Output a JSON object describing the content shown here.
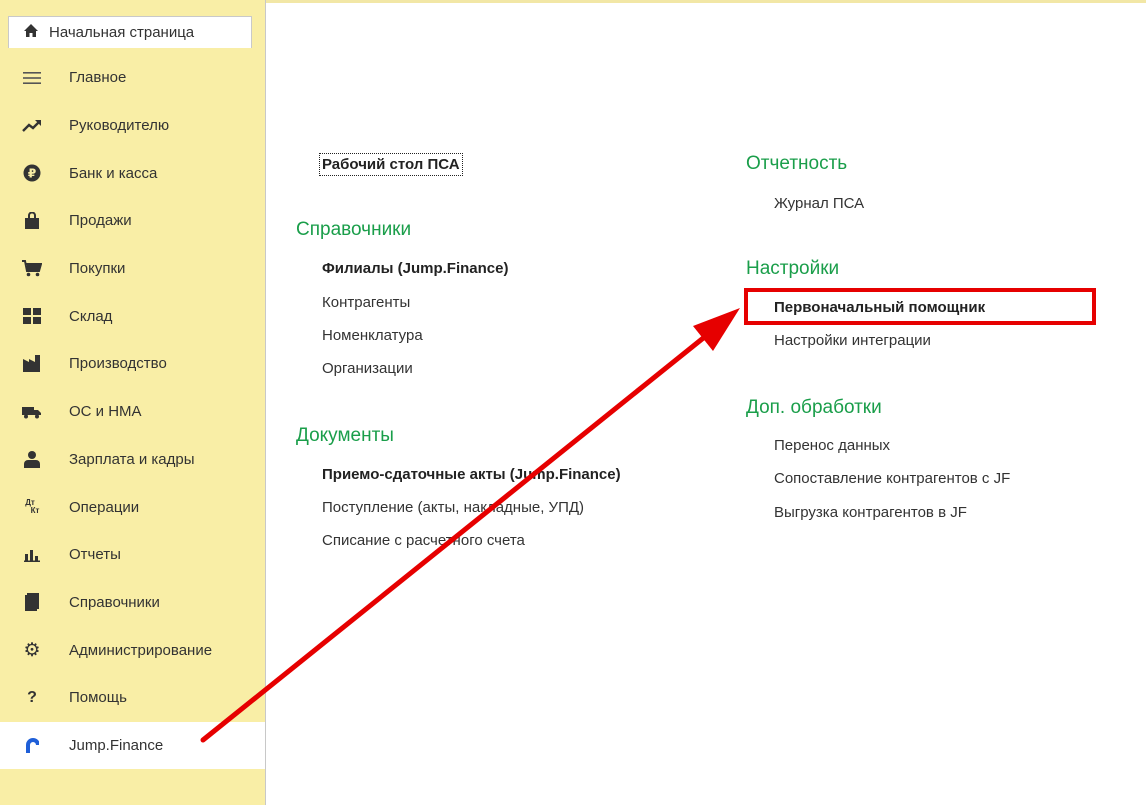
{
  "home_tab": {
    "label": "Начальная страница",
    "icon": "home-icon"
  },
  "sidebar": {
    "items": [
      {
        "label": "Главное",
        "icon": "menu-lines-icon"
      },
      {
        "label": "Руководителю",
        "icon": "trend-up-icon"
      },
      {
        "label": "Банк и касса",
        "icon": "ruble-coin-icon"
      },
      {
        "label": "Продажи",
        "icon": "shopping-bag-icon"
      },
      {
        "label": "Покупки",
        "icon": "cart-icon"
      },
      {
        "label": "Склад",
        "icon": "warehouse-grid-icon"
      },
      {
        "label": "Производство",
        "icon": "factory-icon"
      },
      {
        "label": "ОС и НМА",
        "icon": "truck-icon"
      },
      {
        "label": "Зарплата и кадры",
        "icon": "person-icon"
      },
      {
        "label": "Операции",
        "icon": "debit-credit-icon",
        "glyph_top": "Дт",
        "glyph_bottom": "Кт"
      },
      {
        "label": "Отчеты",
        "icon": "bar-chart-icon"
      },
      {
        "label": "Справочники",
        "icon": "book-icon"
      },
      {
        "label": "Администрирование",
        "icon": "gear-icon"
      },
      {
        "label": "Помощь",
        "icon": "question-icon",
        "glyph": "?"
      },
      {
        "label": "Jump.Finance",
        "icon": "jump-finance-logo-icon",
        "active": true
      }
    ]
  },
  "main": {
    "desktop_link": "Рабочий стол ПСА",
    "directories": {
      "title": "Справочники",
      "items": [
        "Филиалы (Jump.Finance)",
        "Контрагенты",
        "Номенклатура",
        "Организации"
      ]
    },
    "documents": {
      "title": "Документы",
      "items": [
        "Приемо-сдаточные акты (Jump.Finance)",
        "Поступление (акты, накладные, УПД)",
        "Списание с расчетного счета"
      ]
    },
    "reports": {
      "title": "Отчетность",
      "items": [
        "Журнал ПСА"
      ]
    },
    "settings": {
      "title": "Настройки",
      "items": [
        "Первоначальный помощник",
        "Настройки интеграции"
      ]
    },
    "extra": {
      "title": "Доп. обработки",
      "items": [
        "Перенос данных",
        "Сопоставление контрагентов с JF",
        "Выгрузка контрагентов в JF"
      ]
    }
  },
  "colors": {
    "sidebar_bg": "#f9eea6",
    "section_title": "#1a9e4a",
    "annotation_red": "#e60000",
    "active_icon": "#1f5fd8"
  }
}
